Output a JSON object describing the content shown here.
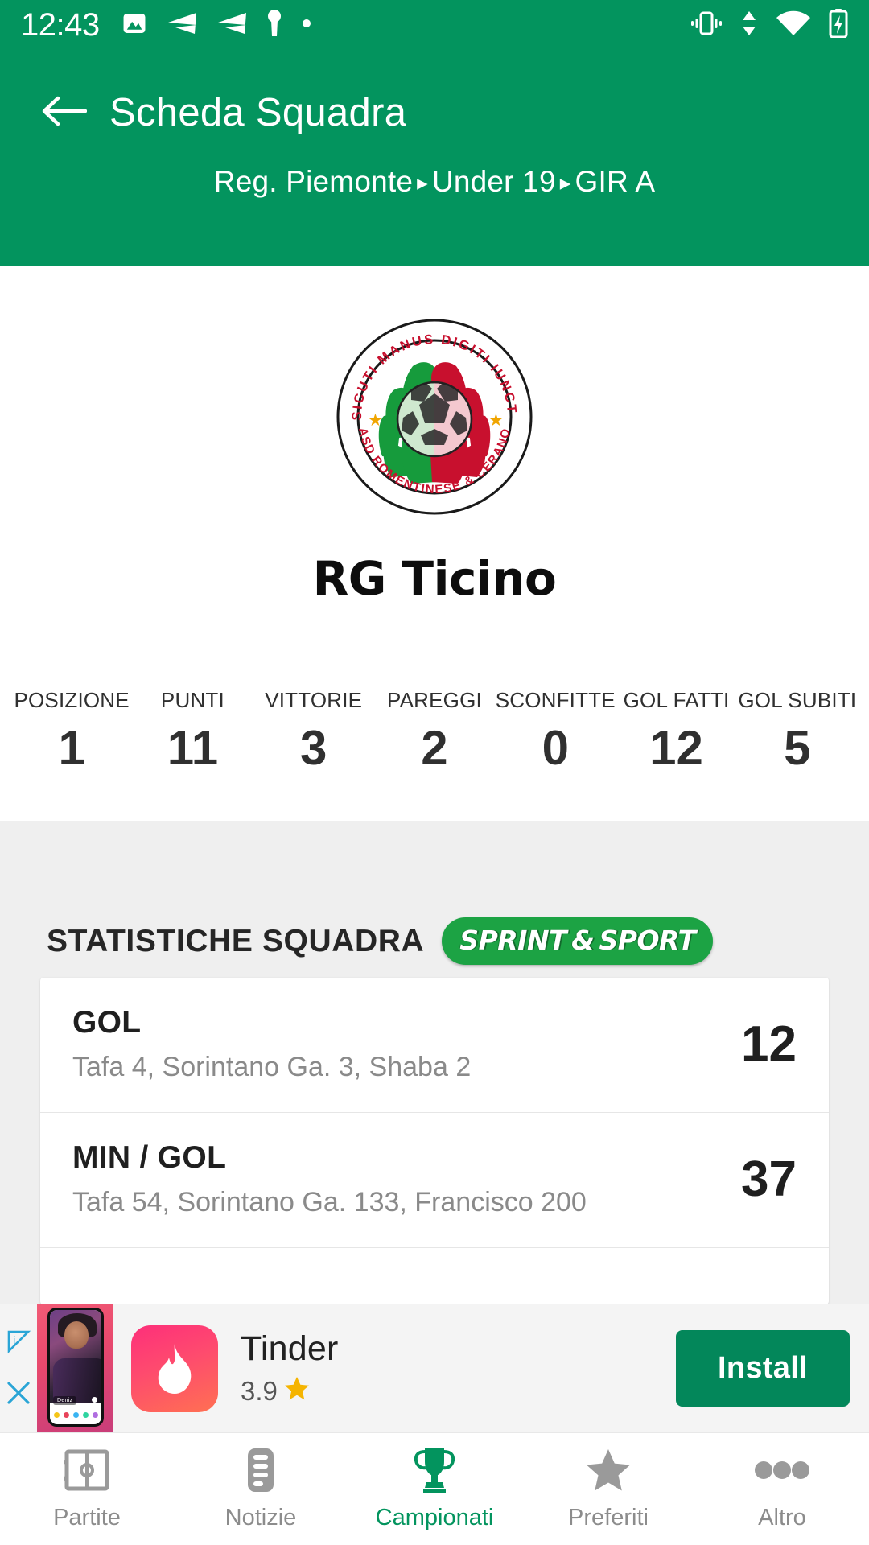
{
  "status_bar": {
    "time": "12:43",
    "left_icons": [
      "image-icon",
      "telegram-arrow-icon",
      "telegram-arrow-icon",
      "vpn-key-icon",
      "dot-icon"
    ],
    "right_icons": [
      "vibrate-icon",
      "data-transfer-icon",
      "wifi-icon",
      "battery-charging-icon"
    ]
  },
  "header": {
    "title": "Scheda Squadra",
    "back_icon": "back-arrow-icon",
    "breadcrumb": {
      "region": "Reg. Piemonte",
      "category": "Under 19",
      "group": "GIR A",
      "separator": "▸"
    },
    "background_color": "#03945e"
  },
  "team": {
    "name": "RG Ticino",
    "crest": {
      "top_motto": "SICUTI MANUS DIGITI IUNCTI",
      "bottom_name": "ASD ROMENTINESE & CERANO",
      "colors": {
        "green": "#1f9c3d",
        "red": "#c8102e",
        "ring": "#ffffff"
      }
    }
  },
  "stats": [
    {
      "label": "POSIZIONE",
      "value": "1"
    },
    {
      "label": "PUNTI",
      "value": "11"
    },
    {
      "label": "VITTORIE",
      "value": "3"
    },
    {
      "label": "PAREGGI",
      "value": "2"
    },
    {
      "label": "SCONFITTE",
      "value": "0"
    },
    {
      "label": "GOL FATTI",
      "value": "12"
    },
    {
      "label": "GOL SUBITI",
      "value": "5"
    }
  ],
  "section": {
    "title": "STATISTICHE SQUADRA",
    "sponsor": {
      "label": "SPRINT & SPORT",
      "color": "#1ca344"
    },
    "cards": [
      {
        "title": "GOL",
        "subtitle": "Tafa 4, Sorintano Ga. 3, Shaba 2",
        "value": "12"
      },
      {
        "title": "MIN / GOL",
        "subtitle": "Tafa 54, Sorintano Ga. 133, Francisco 200",
        "value": "37"
      }
    ]
  },
  "ad": {
    "adchoices_icon": "adchoices-icon",
    "close_icon": "close-icon",
    "thumbnail": {
      "profile_name": "Deniz"
    },
    "app_icon": "tinder-flame-icon",
    "app_name": "Tinder",
    "rating": "3.9",
    "star_icon": "star-icon",
    "install_label": "Install",
    "install_color": "#03875a"
  },
  "bottom_nav": {
    "active_index": 2,
    "active_color": "#03945e",
    "inactive_color": "#8c8c8c",
    "items": [
      {
        "label": "Partite",
        "icon": "pitch-icon"
      },
      {
        "label": "Notizie",
        "icon": "list-icon"
      },
      {
        "label": "Campionati",
        "icon": "trophy-icon"
      },
      {
        "label": "Preferiti",
        "icon": "star-icon"
      },
      {
        "label": "Altro",
        "icon": "more-dots-icon"
      }
    ]
  }
}
